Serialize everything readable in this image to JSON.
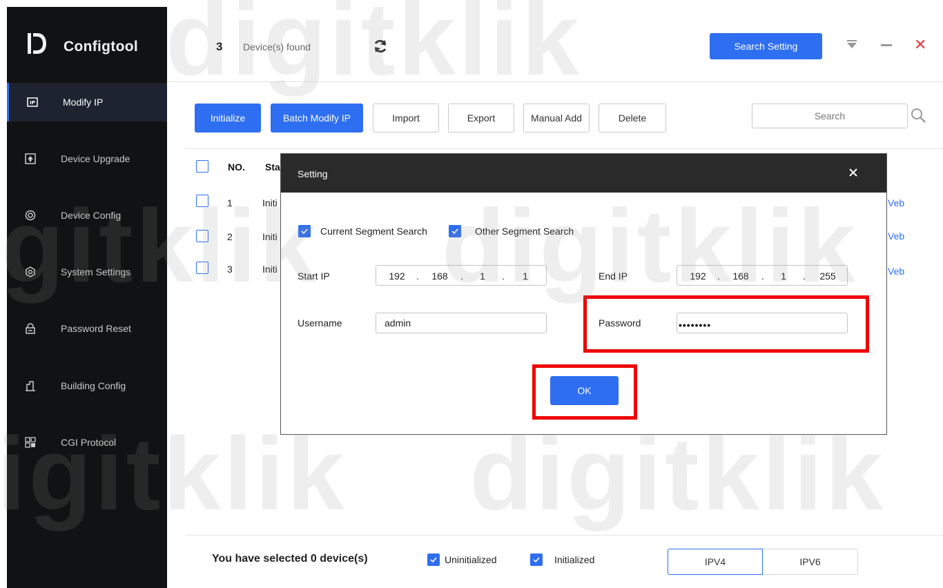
{
  "app": {
    "name": "Configtool"
  },
  "sidebar": {
    "items": [
      {
        "label": "Modify IP",
        "icon": "ip-icon",
        "active": true
      },
      {
        "label": "Device Upgrade",
        "icon": "upgrade-icon",
        "active": false
      },
      {
        "label": "Device Config",
        "icon": "target-icon",
        "active": false
      },
      {
        "label": "System Settings",
        "icon": "settings-icon",
        "active": false
      },
      {
        "label": "Password Reset",
        "icon": "lock-icon",
        "active": false
      },
      {
        "label": "Building Config",
        "icon": "building-icon",
        "active": false
      },
      {
        "label": "CGI Protocol",
        "icon": "grid-icon",
        "active": false
      }
    ]
  },
  "header": {
    "device_count": "3",
    "found_label": "Device(s) found",
    "search_setting_label": "Search Setting"
  },
  "toolbar": {
    "initialize": "Initialize",
    "batch_modify": "Batch Modify IP",
    "import": "Import",
    "export": "Export",
    "manual_add": "Manual Add",
    "delete": "Delete",
    "search_placeholder": "Search"
  },
  "table": {
    "columns": [
      "NO.",
      "Sta"
    ],
    "rows": [
      {
        "no": "1",
        "status": "Initi",
        "action": "Veb"
      },
      {
        "no": "2",
        "status": "Initi",
        "action": "Veb"
      },
      {
        "no": "3",
        "status": "Initi",
        "action": "Veb"
      }
    ]
  },
  "modal": {
    "title": "Setting",
    "current_segment": "Current Segment Search",
    "other_segment": "Other Segment Search",
    "start_ip_label": "Start IP",
    "start_ip": [
      "192",
      "168",
      "1",
      "1"
    ],
    "end_ip_label": "End IP",
    "end_ip": [
      "192",
      "168",
      "1",
      "255"
    ],
    "username_label": "Username",
    "username_value": "admin",
    "password_label": "Password",
    "password_mask": "••••••••",
    "ok_label": "OK"
  },
  "footer": {
    "selected_text": "You have selected 0  device(s)",
    "uninitialized": "Uninitialized",
    "initialized": "Initialized",
    "ipv4": "IPV4",
    "ipv6": "IPV6"
  },
  "colors": {
    "accent": "#2e6ef0",
    "sidebar_bg": "#111213",
    "highlight": "#ee0000"
  },
  "watermark": {
    "text": "digitklik"
  }
}
